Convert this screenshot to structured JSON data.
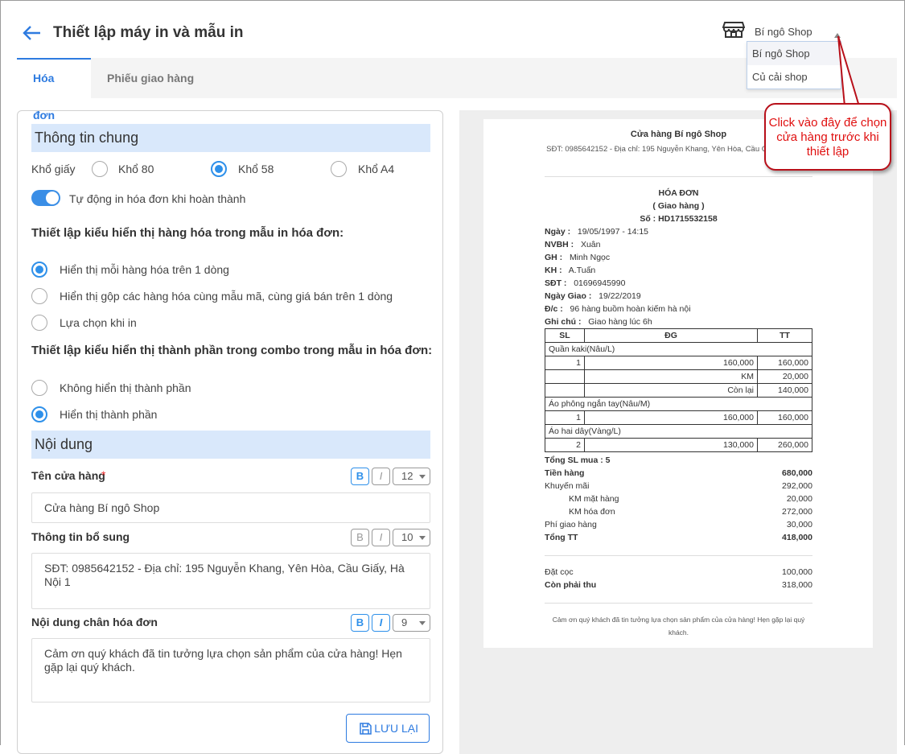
{
  "header": {
    "title": "Thiết lập máy in và mẫu in",
    "store_selected": "Bí ngô Shop"
  },
  "tabs": [
    {
      "label": "Hóa đơn"
    },
    {
      "label": "Phiếu giao hàng"
    }
  ],
  "store_dropdown": {
    "options": [
      "Bí ngô Shop",
      "Củ cải shop"
    ]
  },
  "callout": {
    "text": "Click vào đây để chọn cửa hàng trước khi thiết lập"
  },
  "general": {
    "title": "Thông tin chung",
    "paper_label": "Khổ giấy",
    "paper_options": [
      "Khổ 80",
      "Khổ 58",
      "Khổ A4"
    ],
    "paper_selected": "Khổ 58",
    "auto_print": "Tự động in hóa đơn khi hoàn thành",
    "item_display_title": "Thiết lập kiểu hiển thị hàng hóa trong mẫu in hóa đơn:",
    "item_display_options": [
      "Hiển thị mỗi hàng hóa trên 1 dòng",
      "Hiển thị gộp các hàng hóa cùng mẫu mã, cùng giá bán trên 1 dòng",
      "Lựa chọn khi in"
    ],
    "combo_title": "Thiết lập kiểu hiển thị thành phần trong combo trong mẫu in hóa đơn:",
    "combo_options": [
      "Không hiển thị thành phần",
      "Hiển thị thành phần"
    ]
  },
  "content": {
    "title": "Nội dung",
    "store_name_label": "Tên cửa hàng",
    "required": "*",
    "store_name_value": "Cửa hàng Bí ngô Shop",
    "store_name_size": "12",
    "extra_label": "Thông tin bổ sung",
    "extra_value": "SĐT: 0985642152 - Địa chỉ: 195 Nguyễn Khang, Yên Hòa, Cầu Giấy, Hà Nội 1",
    "extra_size": "10",
    "footer_label": "Nội dung chân hóa đơn",
    "footer_value": "Cảm ơn quý khách đã tin tưởng lựa chọn sản phẩm của cửa hàng! Hẹn gặp lại quý khách.",
    "footer_size": "9",
    "bold": "B",
    "italic": "I",
    "save": "LƯU LẠI"
  },
  "receipt": {
    "store": "Cửa hàng Bí ngô Shop",
    "info": "SĐT: 0985642152 - Địa chỉ: 195 Nguyễn Khang, Yên Hòa, Cầu Giấy, Hà Nội 1",
    "title": "HÓA ĐƠN",
    "subtitle": "( Giao hàng )",
    "number": "Số : HD1715532158",
    "fields": [
      [
        "Ngày :",
        "19/05/1997 - 14:15"
      ],
      [
        "NVBH :",
        "Xuân"
      ],
      [
        "GH :",
        "Minh Ngọc"
      ],
      [
        "KH :",
        "A.Tuấn"
      ],
      [
        "SĐT :",
        "01696945990"
      ],
      [
        "Ngày Giao :",
        "19/22/2019"
      ],
      [
        "Đ/c :",
        "96 hàng buồm hoàn kiếm hà nội"
      ],
      [
        "Ghi chú :",
        "Giao hàng lúc 6h"
      ]
    ],
    "headers": [
      "SL",
      "ĐG",
      "TT"
    ],
    "items": [
      {
        "name": "Quần kaki(Nâu/L)",
        "rows": [
          [
            "1",
            "160,000",
            "160,000"
          ],
          [
            "",
            "KM",
            "20,000"
          ],
          [
            "",
            "Còn lại",
            "140,000"
          ]
        ]
      },
      {
        "name": "Áo phông ngắn tay(Nâu/M)",
        "rows": [
          [
            "1",
            "160,000",
            "160,000"
          ]
        ]
      },
      {
        "name": "Áo hai dây(Vàng/L)",
        "rows": [
          [
            "2",
            "130,000",
            "260,000"
          ]
        ]
      }
    ],
    "total_qty": "Tổng SL mua : 5",
    "summary": [
      [
        "Tiền hàng",
        "680,000"
      ],
      [
        "Khuyến mãi",
        "292,000"
      ],
      [
        "KM mặt hàng",
        "20,000"
      ],
      [
        "KM hóa đơn",
        "272,000"
      ],
      [
        "Phí giao hàng",
        "30,000"
      ],
      [
        "Tổng TT",
        "418,000"
      ]
    ],
    "deposit": [
      "Đặt cọc",
      "100,000"
    ],
    "remaining": [
      "Còn phải thu",
      "318,000"
    ],
    "footer": "Cảm ơn quý khách đã tin tưởng lựa chọn sản phẩm của cửa hàng! Hẹn gặp lại quý khách."
  },
  "colors": {
    "accent": "#2e7be0",
    "section_bg": "#d9e8fb",
    "callout": "#e01010"
  }
}
